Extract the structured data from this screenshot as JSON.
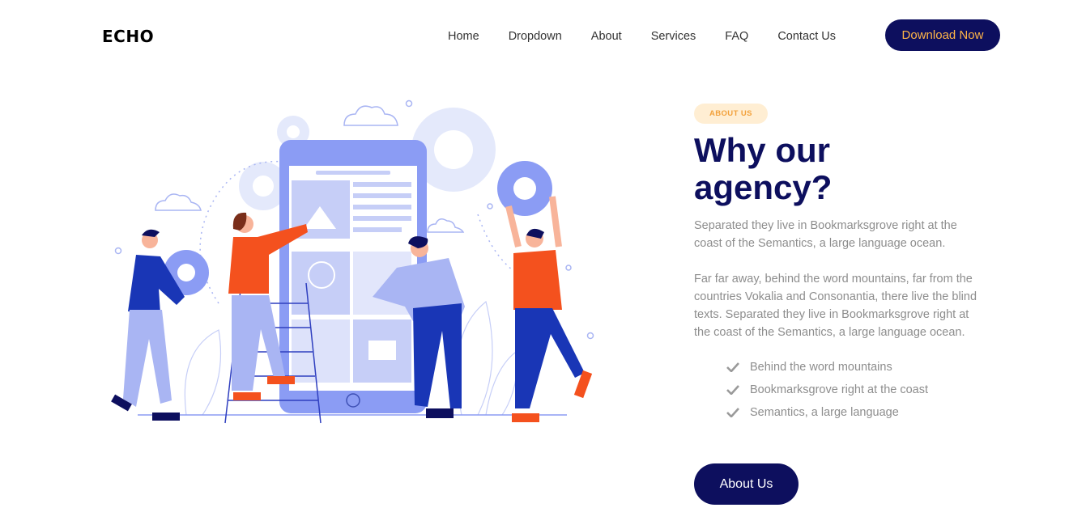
{
  "brand": {
    "logo": "ECHO"
  },
  "nav": {
    "items": [
      {
        "label": "Home"
      },
      {
        "label": "Dropdown"
      },
      {
        "label": "About"
      },
      {
        "label": "Services"
      },
      {
        "label": "FAQ"
      },
      {
        "label": "Contact Us"
      }
    ],
    "cta_label": "Download Now"
  },
  "about": {
    "badge": "ABOUT US",
    "title": "Why our agency?",
    "paragraph_1": "Separated they live in Bookmarksgrove right at the coast of the Semantics, a large language ocean.",
    "paragraph_2": "Far far away, behind the word mountains, far from the countries Vokalia and Consonantia, there live the blind texts. Separated they live in Bookmarksgrove right at the coast of the Semantics, a large language ocean.",
    "checklist": [
      {
        "text": "Behind the word mountains"
      },
      {
        "text": "Bookmarksgrove right at the coast"
      },
      {
        "text": "Semantics, a large language"
      }
    ],
    "button_label": "About Us"
  },
  "illustration": {
    "icon": "team-building-app-illustration"
  },
  "colors": {
    "navy": "#0d0f5e",
    "accent_orange": "#ffb547",
    "badge_bg": "#ffeed3",
    "illustration_blue": "#8b9cf4",
    "illustration_red": "#f4511e"
  }
}
